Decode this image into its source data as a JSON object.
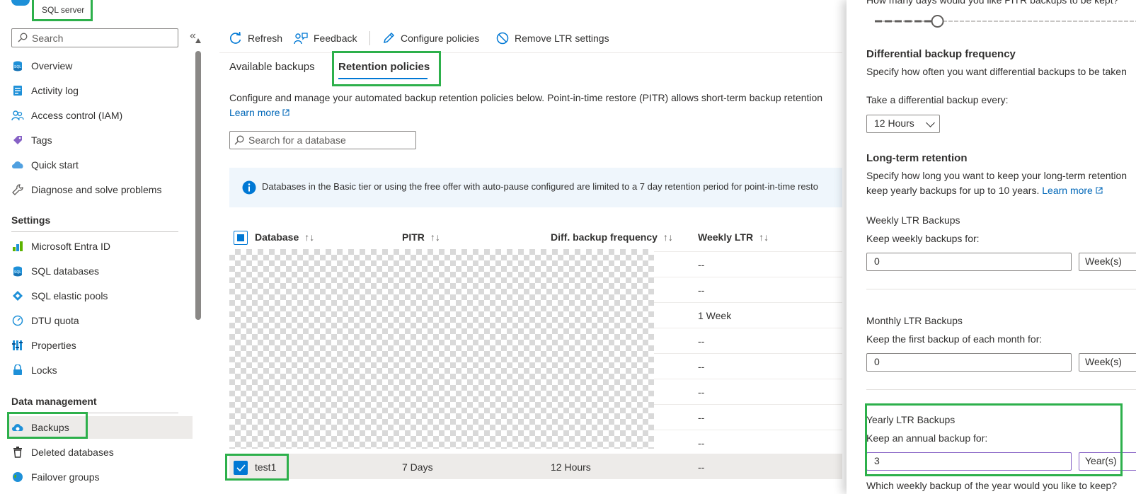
{
  "resource": {
    "kind": "SQL server"
  },
  "nav": {
    "search_placeholder": "Search",
    "collapse": "«",
    "items": [
      {
        "label": "Overview",
        "icon": "sql-icon"
      },
      {
        "label": "Activity log",
        "icon": "activity-log-icon"
      },
      {
        "label": "Access control (IAM)",
        "icon": "people-icon"
      },
      {
        "label": "Tags",
        "icon": "tag-icon"
      },
      {
        "label": "Quick start",
        "icon": "cloud-icon"
      },
      {
        "label": "Diagnose and solve problems",
        "icon": "wrench-icon"
      }
    ],
    "settings_title": "Settings",
    "settings_items": [
      {
        "label": "Microsoft Entra ID",
        "icon": "entra-icon"
      },
      {
        "label": "SQL databases",
        "icon": "sql-icon"
      },
      {
        "label": "SQL elastic pools",
        "icon": "elastic-pool-icon"
      },
      {
        "label": "DTU quota",
        "icon": "gauge-icon"
      },
      {
        "label": "Properties",
        "icon": "properties-icon"
      },
      {
        "label": "Locks",
        "icon": "lock-icon"
      }
    ],
    "data_title": "Data management",
    "data_items": [
      {
        "label": "Backups",
        "icon": "backup-cloud-icon"
      },
      {
        "label": "Deleted databases",
        "icon": "trash-icon"
      },
      {
        "label": "Failover groups",
        "icon": "globe-icon"
      }
    ]
  },
  "toolbar": {
    "refresh": "Refresh",
    "feedback": "Feedback",
    "configure": "Configure policies",
    "remove": "Remove LTR settings"
  },
  "tabs": {
    "available": "Available backups",
    "retention": "Retention policies"
  },
  "description": "Configure and manage your automated backup retention policies below. Point-in-time restore (PITR) allows short-term backup retention",
  "learn_more": "Learn more",
  "db_search_placeholder": "Search for a database",
  "info_text": "Databases in the Basic tier or using the free offer with auto-pause configured are limited to a 7 day retention period for point-in-time resto",
  "table": {
    "headers": {
      "database": "Database",
      "pitr": "PITR",
      "diff": "Diff. backup frequency",
      "weekly": "Weekly LTR",
      "sort": "↑↓"
    },
    "weekly_values": [
      "--",
      "--",
      "1 Week",
      "--",
      "--",
      "--",
      "--",
      "--"
    ],
    "selected_row": {
      "database": "test1",
      "pitr": "7 Days",
      "diff": "12 Hours",
      "weekly": "--"
    }
  },
  "panel": {
    "pitr_question": "How many days would you like PITR backups to be kept?",
    "pitr_slider_fraction": 0.24,
    "diff_title": "Differential backup frequency",
    "diff_desc": "Specify how often you want differential backups to be taken",
    "diff_label": "Take a differential backup every:",
    "diff_value": "12 Hours",
    "ltr_title": "Long-term retention",
    "ltr_desc1": "Specify how long you want to keep your long-term retention",
    "ltr_desc2": "keep yearly backups for up to 10 years.",
    "ltr_learn": "Learn more",
    "weekly_title": "Weekly LTR Backups",
    "weekly_label": "Keep weekly backups for:",
    "weekly_value": "0",
    "weekly_unit": "Week(s)",
    "monthly_title": "Monthly LTR Backups",
    "monthly_label": "Keep the first backup of each month for:",
    "monthly_value": "0",
    "monthly_unit": "Week(s)",
    "yearly_title": "Yearly LTR Backups",
    "yearly_label": "Keep an annual backup for:",
    "yearly_value": "3",
    "yearly_unit": "Year(s)",
    "yearly_question": "Which weekly backup of the year would you like to keep?"
  },
  "colors": {
    "accent": "#0078d4",
    "highlight": "#2db04b",
    "link": "#0067b8"
  }
}
